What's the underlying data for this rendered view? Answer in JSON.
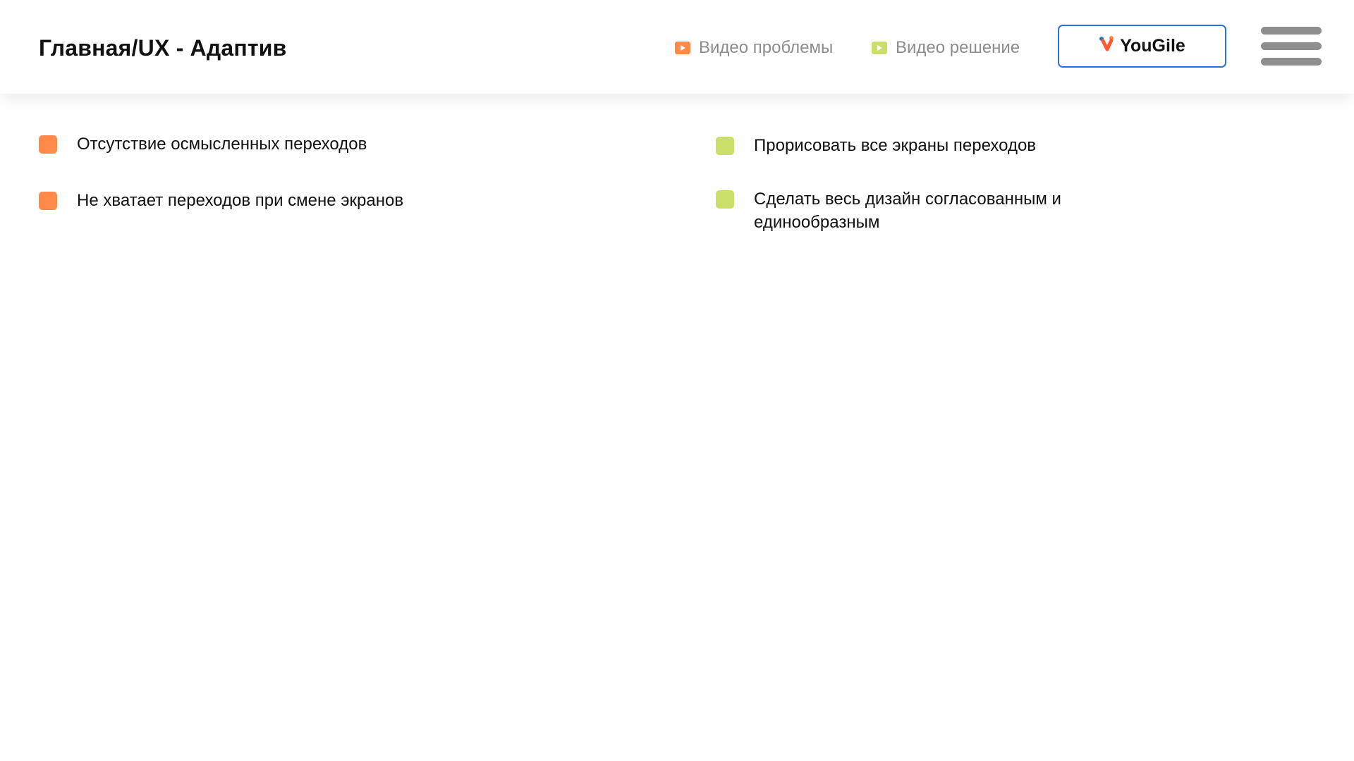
{
  "header": {
    "title": "Главная/UX - Адаптив",
    "video_problem_label": "Видео проблемы",
    "video_solution_label": "Видео решение",
    "yougile_label": "YouGile",
    "menu_icon": "hamburger-menu-icon"
  },
  "colors": {
    "problem": "#ff8a48",
    "solution": "#c9df6a",
    "button_border": "#2a72d9"
  },
  "problems": [
    {
      "text": "Отсутствие осмысленных переходов"
    },
    {
      "text": "Не хватает переходов при смене экранов"
    }
  ],
  "solutions": [
    {
      "text": "Прорисовать все экраны переходов"
    },
    {
      "text": "Сделать весь дизайн согласованным и единообразным"
    }
  ]
}
